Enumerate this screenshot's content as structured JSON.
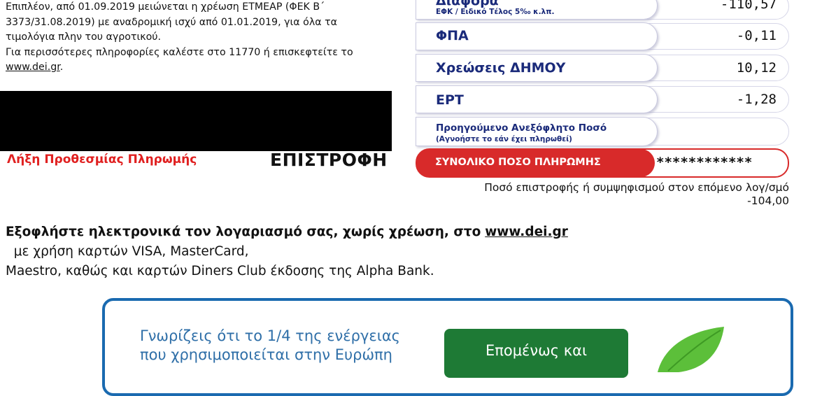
{
  "info": {
    "line1": "Επιπλέον, από 01.09.2019 μειώνεται η χρέωση ΕΤΜΕΑΡ (ΦΕΚ Β΄",
    "line2": "3373/31.08.2019) με αναδρομική ισχύ από 01.01.2019, για όλα τα",
    "line3": "τιμολόγια πλην του αγροτικού.",
    "line4": "Για περισσότερες πληροφορίες καλέστε στο 11770 ή επισκεφτείτε το",
    "link": "www.dei.gr",
    "link_suffix": "."
  },
  "deadline_label": "Λήξη Προθεσμίας Πληρωμής",
  "refund_word": "ΕΠΙΣΤΡΟΦΗ",
  "charges": [
    {
      "label": "Διάφορα",
      "sublabel": "ΕΦΚ / Ειδικό Τέλος 5‰  κ.λπ.",
      "value": "-110,57"
    },
    {
      "label": "ΦΠΑ",
      "value": "-0,11"
    },
    {
      "label": "Χρεώσεις  ΔΗΜΟΥ",
      "value": "10,12"
    },
    {
      "label": "ΕΡΤ",
      "value": "-1,28"
    },
    {
      "label": "Προηγούμενο Ανεξόφλητο Ποσό",
      "sublabel": "(Αγνοήστε το εάν έχει πληρωθεί)",
      "value": ""
    }
  ],
  "total": {
    "label": "ΣΥΝΟΛΙΚΟ  ΠΟΣΟ  ΠΛΗΡΩΜΗΣ",
    "value": "************"
  },
  "refund_note": {
    "line1": "Ποσό επιστροφής ή συμψηφισμού στον επόμενο λογ/σμό",
    "amount": "-104,00"
  },
  "pay": {
    "bold": "Εξοφλήστε ηλεκτρονικά τον λογαριασμό σας, χωρίς χρέωση, στο",
    "link": "www.dei.gr",
    "rest": "  με χρήση καρτών VISA, MasterCard,",
    "line2": "Maestro, καθώς και καρτών Diners Club έκδοσης της Alpha Bank."
  },
  "banner": {
    "line1": "Γνωρίζεις ότι το 1/4 της ενέργειας",
    "line2": "που χρησιμοποιείται στην Ευρώπη",
    "button_line1": "Επομένως και"
  },
  "colors": {
    "accent_red": "#d82a2a",
    "label_blue": "#1a2a7a",
    "banner_blue": "#1a6ab0",
    "banner_green": "#1e7a35",
    "leaf_green": "#5cbf3a"
  }
}
